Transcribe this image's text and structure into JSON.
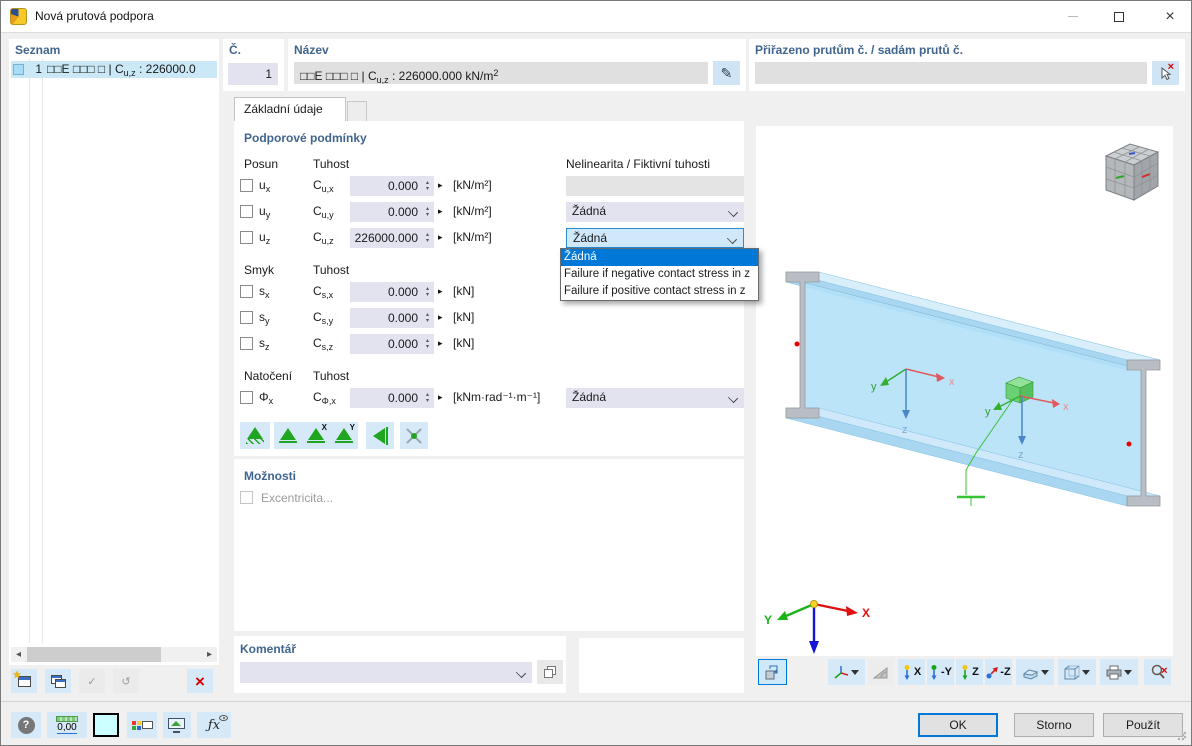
{
  "window": {
    "title": "Nová prutová podpora"
  },
  "colors": {
    "accent": "#0078d7",
    "selection": "#cbe8f6",
    "header_text": "#41658e",
    "support_green": "#1fa51f",
    "beam_blue": "#b3e0f8"
  },
  "glyphs": {
    "spin_up": "▴",
    "spin_down": "▾",
    "pick": "▸",
    "scroll_left": "◂",
    "scroll_right": "▸",
    "close": "×",
    "star": "★",
    "check": "✓",
    "delete": "×",
    "pencil": "✎",
    "question": "?",
    "undo": "↺",
    "redx": "×"
  },
  "seznam": {
    "header": "Seznam",
    "item": {
      "number": "1",
      "prefix": "□□E □□□ □ | ",
      "sym": "C",
      "sym_sub": "u,z",
      "rest": " : 226000.0"
    }
  },
  "cislo": {
    "label": "Č.",
    "value": "1"
  },
  "nazev": {
    "label": "Název",
    "prefix": "□□E □□□ □ | ",
    "sym": "C",
    "sym_sub": "u,z",
    "rest": " : 226000.000 kN/m",
    "sup": "2"
  },
  "prirazeno": {
    "label": "Přiřazeno prutům č. / sadám prutů č.",
    "value": ""
  },
  "tabs": {
    "active": "Základní údaje"
  },
  "podminky": {
    "title": "Podporové podmínky",
    "posun": "Posun",
    "tuhost": "Tuhost",
    "nelinearita": "Nelinearita / Fiktivní tuhosti",
    "smyk": "Smyk",
    "tuhost2": "Tuhost",
    "natoceni": "Natočení",
    "tuhost3": "Tuhost",
    "rows": {
      "ux": {
        "base": "u",
        "sub": "x",
        "sym": "C",
        "symsub": "u,x",
        "value": "0.000",
        "unit": "[kN/m²]"
      },
      "uy": {
        "base": "u",
        "sub": "y",
        "sym": "C",
        "symsub": "u,y",
        "value": "0.000",
        "unit": "[kN/m²]",
        "nonlin": "Žádná"
      },
      "uz": {
        "base": "u",
        "sub": "z",
        "sym": "C",
        "symsub": "u,z",
        "value": "226000.000",
        "unit": "[kN/m²]",
        "nonlin": "Žádná"
      },
      "sx": {
        "base": "s",
        "sub": "x",
        "sym": "C",
        "symsub": "s,x",
        "value": "0.000",
        "unit": "[kN]"
      },
      "sy": {
        "base": "s",
        "sub": "y",
        "sym": "C",
        "symsub": "s,y",
        "value": "0.000",
        "unit": "[kN]"
      },
      "sz": {
        "base": "s",
        "sub": "z",
        "sym": "C",
        "symsub": "s,z",
        "value": "0.000",
        "unit": "[kN]"
      },
      "phix": {
        "base": "Φ",
        "sub": "x",
        "sym": "C",
        "symsub": "Φ,x",
        "value": "0.000",
        "unit": "[kNm·rad⁻¹·m⁻¹]",
        "nonlin": "Žádná"
      }
    },
    "dropdown": {
      "items": [
        "Žádná",
        "Failure if negative contact stress in z",
        "Failure if positive contact stress in z"
      ],
      "selected_index": 0
    },
    "support_buttons": {
      "x_sup": "X",
      "y_sup": "Y"
    }
  },
  "moznosti": {
    "title": "Možnosti",
    "excentricita": "Excentricita..."
  },
  "komentar": {
    "title": "Komentář",
    "value": ""
  },
  "viewport": {
    "axes": {
      "x": "x",
      "y": "y",
      "z": "z",
      "gx": "X",
      "gy": "Y",
      "gz": "Z"
    },
    "views": {
      "x": "X",
      "yneg": "-Y",
      "z": "Z",
      "zneg": "-Z"
    }
  },
  "footer": {
    "ok": "OK",
    "storno": "Storno",
    "pouzit": "Použít",
    "units": "0,00"
  }
}
